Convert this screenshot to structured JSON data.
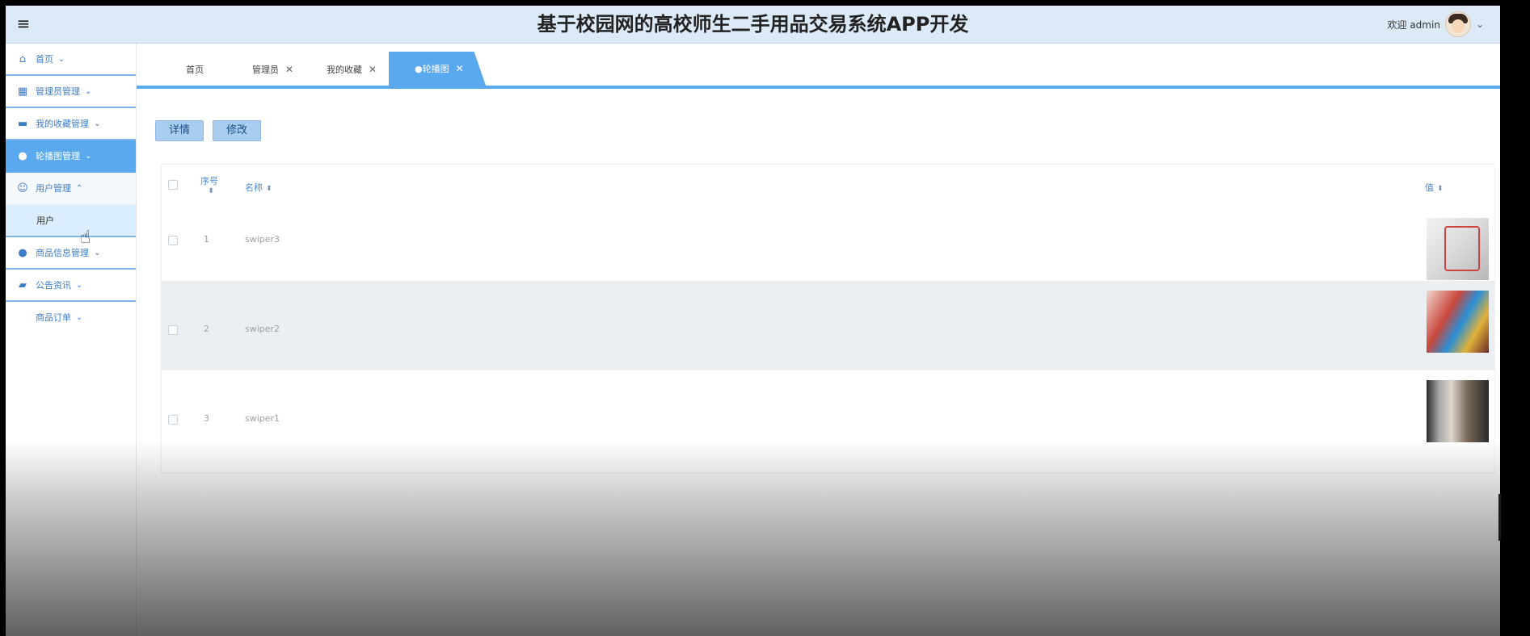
{
  "header": {
    "menu_icon": "hamburger-icon",
    "title": "基于校园网的高校师生二手用品交易系统APP开发",
    "welcome": "欢迎 admin",
    "user_menu_icon": "chevron-down-icon"
  },
  "sidebar": {
    "items": [
      {
        "label": "首页",
        "icon": "home-icon"
      },
      {
        "label": "管理员管理",
        "icon": "grid-icon"
      },
      {
        "label": "我的收藏管理",
        "icon": "folder-icon"
      },
      {
        "label": "轮播图管理",
        "icon": "circle-icon"
      },
      {
        "label": "用户管理",
        "icon": "user-icon"
      },
      {
        "label": "用户"
      },
      {
        "label": "商品信息管理",
        "icon": "circle-icon"
      },
      {
        "label": "公告资讯",
        "icon": "briefcase-icon"
      },
      {
        "label": "商品订单"
      }
    ]
  },
  "tabs": [
    {
      "label": "首页"
    },
    {
      "label": "管理员"
    },
    {
      "label": "我的收藏"
    },
    {
      "label": "●轮播图",
      "active": true
    }
  ],
  "toolbar": {
    "detail_label": "详情",
    "edit_label": "修改"
  },
  "table": {
    "columns": {
      "index": "序号",
      "name": "名称",
      "value": "值"
    },
    "rows": [
      {
        "index": "1",
        "name": "swiper3",
        "image": "shopping-cart-photo"
      },
      {
        "index": "2",
        "name": "swiper2",
        "image": "shopping-bags-photo"
      },
      {
        "index": "3",
        "name": "swiper1",
        "image": "store-interior-photo"
      }
    ]
  },
  "colors": {
    "accent": "#5aa8ee",
    "header_bg": "#dce9f6"
  }
}
